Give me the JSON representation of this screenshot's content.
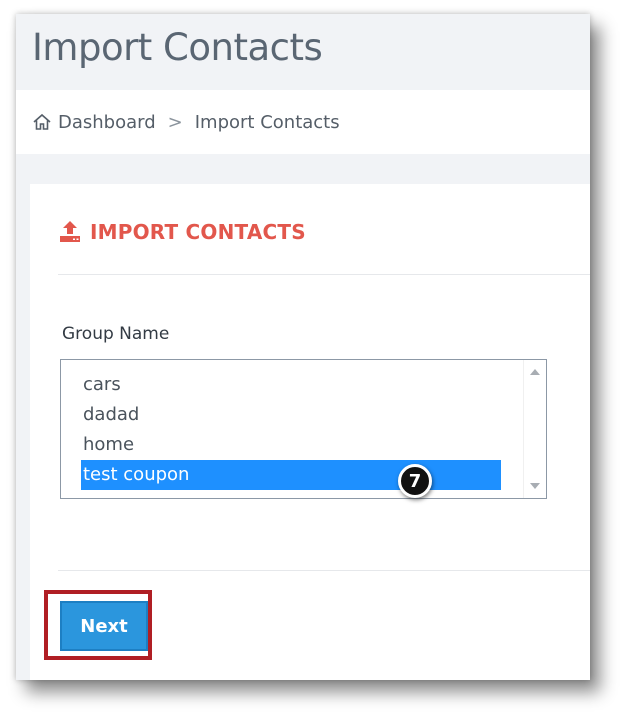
{
  "page": {
    "title": "Import Contacts"
  },
  "breadcrumb": {
    "home_icon": "home-icon",
    "home_label": "Dashboard",
    "separator": ">",
    "current": "Import Contacts"
  },
  "card": {
    "icon": "upload-icon",
    "title": "IMPORT CONTACTS",
    "title_color": "#e2574c"
  },
  "form": {
    "group_label": "Group Name",
    "options": [
      "cars",
      "dadad",
      "home",
      "test coupon"
    ],
    "selected": "test coupon",
    "selected_color": "#1e90ff"
  },
  "annotation": {
    "step_number": "7"
  },
  "actions": {
    "next_label": "Next",
    "button_color": "#2b96dd",
    "highlight_color": "#b01e24"
  }
}
